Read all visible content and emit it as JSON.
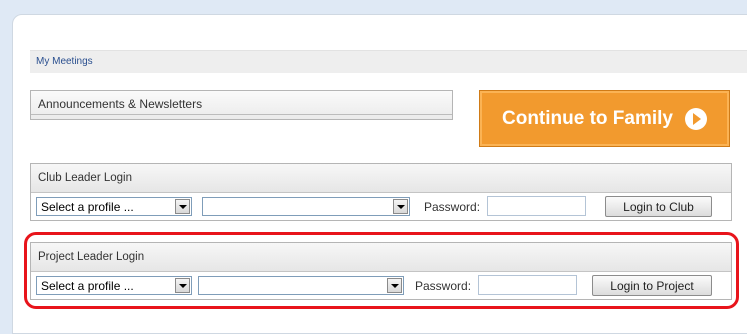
{
  "meetings": {
    "label": "My Meetings"
  },
  "announcements": {
    "label": "Announcements & Newsletters"
  },
  "continue_button": {
    "label": "Continue to Family"
  },
  "club_login": {
    "title": "Club Leader Login",
    "profile_select": "Select a profile ...",
    "second_select": "",
    "password_label": "Password:",
    "password_value": "",
    "button_label": "Login to Club"
  },
  "project_login": {
    "title": "Project Leader Login",
    "profile_select": "Select a profile ...",
    "second_select": "",
    "password_label": "Password:",
    "password_value": "",
    "button_label": "Login to Project"
  },
  "colors": {
    "accent_orange": "#f29a2e",
    "highlight_red": "#e8141b",
    "link_blue": "#2a4f8f"
  }
}
